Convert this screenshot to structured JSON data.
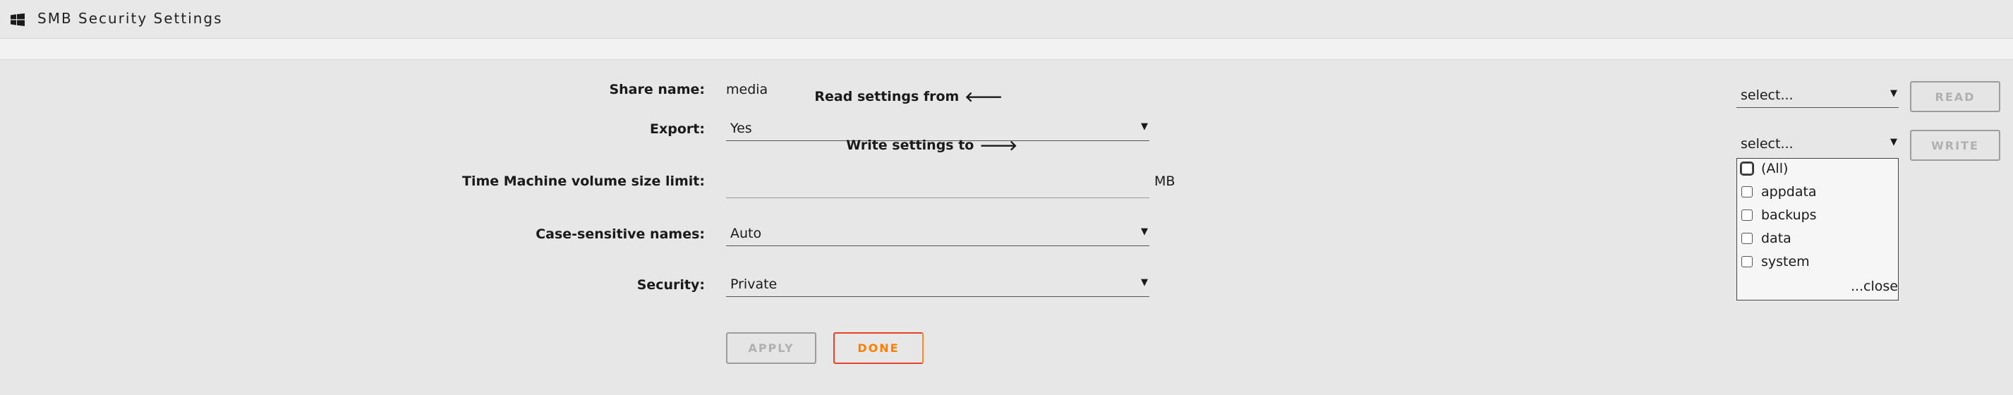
{
  "window": {
    "title": "SMB Security Settings",
    "icon": "windows-logo-icon"
  },
  "form": {
    "share_name_label": "Share name:",
    "share_name_value": "media",
    "export_label": "Export:",
    "export_value": "Yes",
    "tm_label": "Time Machine volume size limit:",
    "tm_value": "",
    "tm_unit": "MB",
    "case_label": "Case-sensitive names:",
    "case_value": "Auto",
    "security_label": "Security:",
    "security_value": "Private",
    "apply_label": "APPLY",
    "done_label": "DONE"
  },
  "sync": {
    "read_label": "Read settings from",
    "read_arrow": "🡐",
    "read_value": "select...",
    "read_button": "READ",
    "write_label": "Write settings to",
    "write_arrow": "🡒",
    "write_value": "select...",
    "write_button": "WRITE",
    "options": [
      "(All)",
      "appdata",
      "backups",
      "data",
      "system"
    ],
    "close_label": "...close"
  },
  "colors": {
    "accent_red": "#e8412c",
    "accent_orange": "#ff7f00",
    "panel_bg": "#e7e7e7"
  }
}
